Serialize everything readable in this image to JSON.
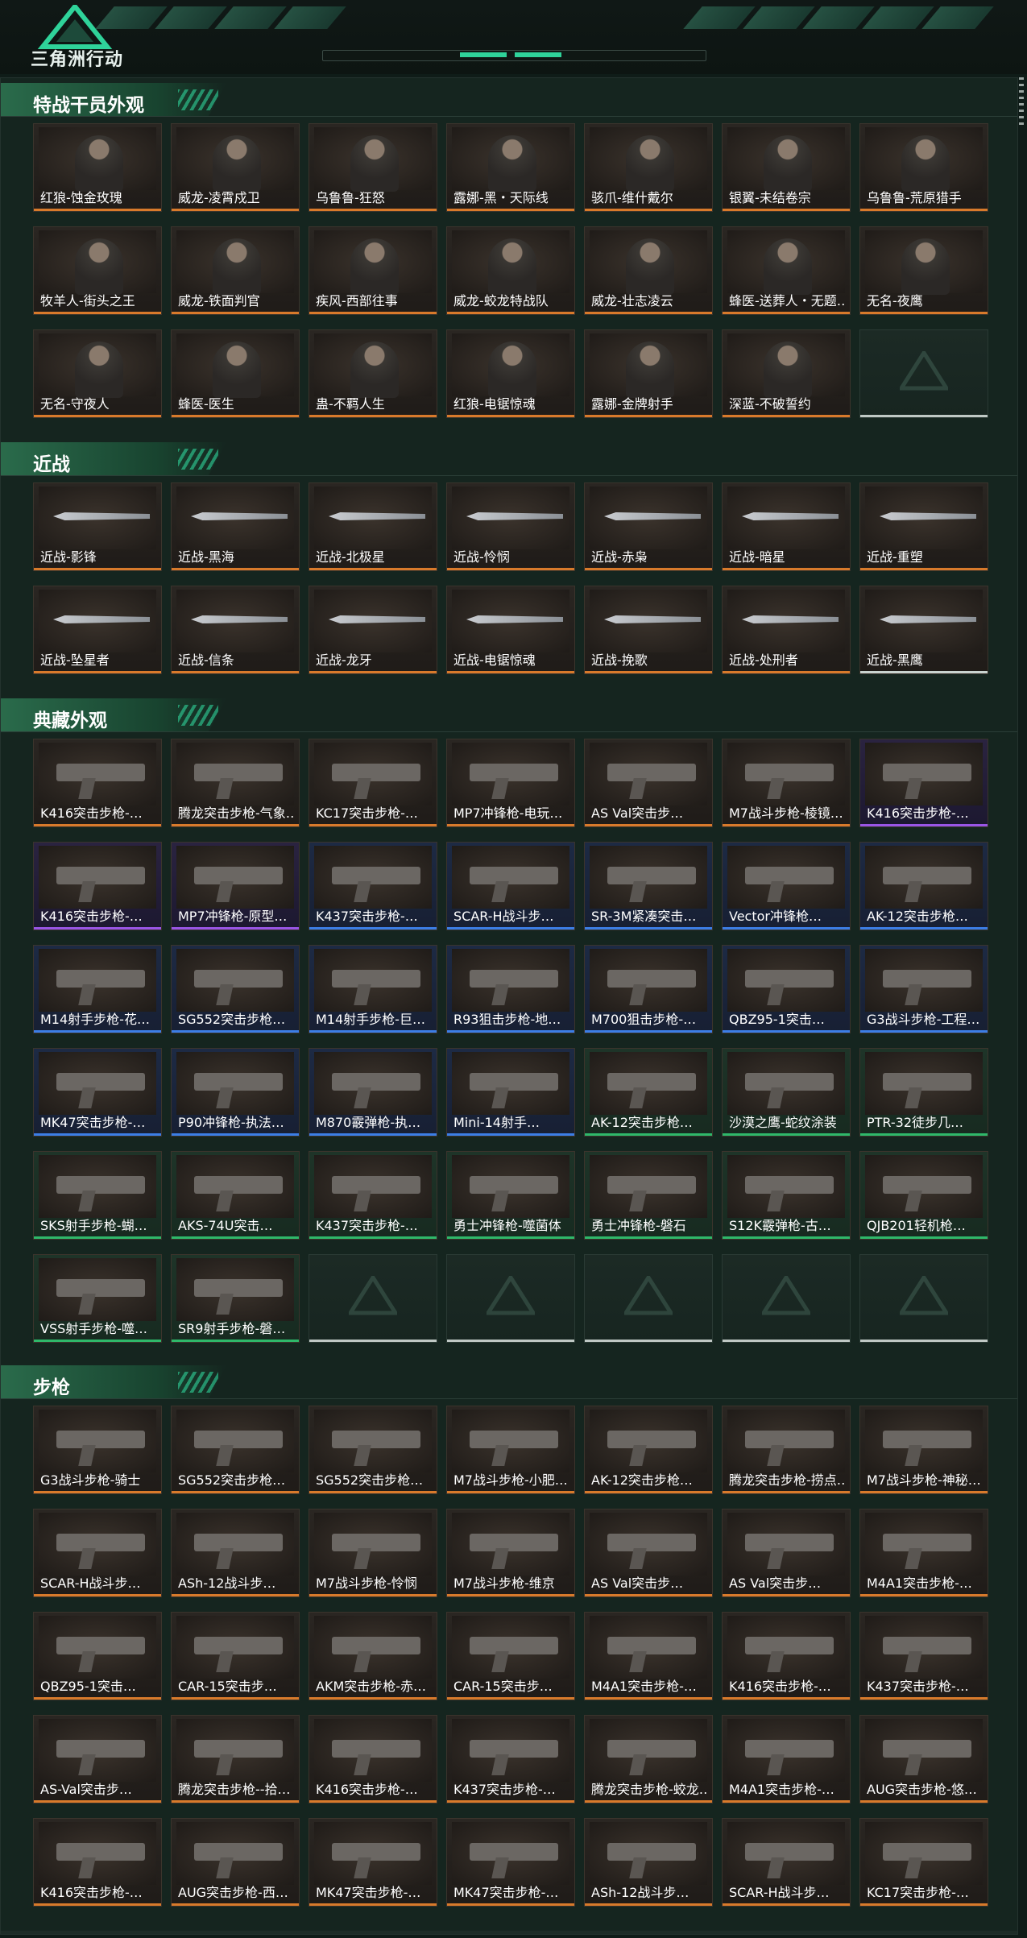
{
  "header": {
    "logo_text": "三角洲行动"
  },
  "sections": [
    {
      "title": "特战干员外观",
      "items": [
        {
          "name": "红狼-蚀金玫瑰",
          "rarity": "red"
        },
        {
          "name": "威龙-凌霄戍卫",
          "rarity": "red"
        },
        {
          "name": "乌鲁鲁-狂怒",
          "rarity": "red"
        },
        {
          "name": "露娜-黑・天际线",
          "rarity": "red"
        },
        {
          "name": "骇爪-维什戴尔",
          "rarity": "red"
        },
        {
          "name": "银翼-未结卷宗",
          "rarity": "orange"
        },
        {
          "name": "乌鲁鲁-荒原猎手",
          "rarity": "orange"
        },
        {
          "name": "牧羊人-街头之王",
          "rarity": "orange"
        },
        {
          "name": "威龙-铁面判官",
          "rarity": "orange"
        },
        {
          "name": "疾风-西部往事",
          "rarity": "orange"
        },
        {
          "name": "威龙-蛟龙特战队",
          "rarity": "orange"
        },
        {
          "name": "威龙-壮志凌云",
          "rarity": "orange"
        },
        {
          "name": "蜂医-送葬人・无题…",
          "rarity": "orange"
        },
        {
          "name": "无名-夜鹰",
          "rarity": "orange"
        },
        {
          "name": "无名-守夜人",
          "rarity": "orange"
        },
        {
          "name": "蜂医-医生",
          "rarity": "orange"
        },
        {
          "name": "蛊-不羁人生",
          "rarity": "orange"
        },
        {
          "name": "红狼-电锯惊魂",
          "rarity": "orange"
        },
        {
          "name": "露娜-金牌射手",
          "rarity": "orange"
        },
        {
          "name": "深蓝-不破誓约",
          "rarity": "orange"
        },
        {
          "name": "",
          "rarity": "empty"
        }
      ]
    },
    {
      "title": "近战",
      "items": [
        {
          "name": "近战-影锋",
          "rarity": "orange"
        },
        {
          "name": "近战-黑海",
          "rarity": "orange"
        },
        {
          "name": "近战-北极星",
          "rarity": "orange"
        },
        {
          "name": "近战-怜悯",
          "rarity": "orange"
        },
        {
          "name": "近战-赤枭",
          "rarity": "orange"
        },
        {
          "name": "近战-暗星",
          "rarity": "orange"
        },
        {
          "name": "近战-重塑",
          "rarity": "orange"
        },
        {
          "name": "近战-坠星者",
          "rarity": "orange"
        },
        {
          "name": "近战-信条",
          "rarity": "orange"
        },
        {
          "name": "近战-龙牙",
          "rarity": "orange"
        },
        {
          "name": "近战-电锯惊魂",
          "rarity": "orange"
        },
        {
          "name": "近战-挽歌",
          "rarity": "orange"
        },
        {
          "name": "近战-处刑者",
          "rarity": "orange"
        },
        {
          "name": "近战-黑鹰",
          "rarity": "white"
        }
      ]
    },
    {
      "title": "典藏外观",
      "items": [
        {
          "name": "K416突击步枪-…",
          "rarity": "orange"
        },
        {
          "name": "腾龙突击步枪-气象…",
          "rarity": "orange"
        },
        {
          "name": "KC17突击步枪-…",
          "rarity": "orange"
        },
        {
          "name": "MP7冲锋枪-电玩…",
          "rarity": "orange"
        },
        {
          "name": "AS Val突击步…",
          "rarity": "orange"
        },
        {
          "name": "M7战斗步枪-棱镜…",
          "rarity": "orange"
        },
        {
          "name": "K416突击步枪-…",
          "rarity": "purple"
        },
        {
          "name": "K416突击步枪-…",
          "rarity": "purple"
        },
        {
          "name": "MP7冲锋枪-原型…",
          "rarity": "purple"
        },
        {
          "name": "K437突击步枪-…",
          "rarity": "blue"
        },
        {
          "name": "SCAR-H战斗步…",
          "rarity": "blue"
        },
        {
          "name": "SR-3M紧凑突击…",
          "rarity": "blue"
        },
        {
          "name": "Vector冲锋枪…",
          "rarity": "blue"
        },
        {
          "name": "AK-12突击步枪…",
          "rarity": "blue"
        },
        {
          "name": "M14射手步枪-花…",
          "rarity": "blue"
        },
        {
          "name": "SG552突击步枪…",
          "rarity": "blue"
        },
        {
          "name": "M14射手步枪-巨…",
          "rarity": "blue"
        },
        {
          "name": "R93狙击步枪-地…",
          "rarity": "blue"
        },
        {
          "name": "M700狙击步枪-…",
          "rarity": "blue"
        },
        {
          "name": "QBZ95-1突击…",
          "rarity": "blue"
        },
        {
          "name": "G3战斗步枪-工程…",
          "rarity": "blue"
        },
        {
          "name": "MK47突击步枪-…",
          "rarity": "blue"
        },
        {
          "name": "P90冲锋枪-执法…",
          "rarity": "blue"
        },
        {
          "name": "M870霰弹枪-执…",
          "rarity": "blue"
        },
        {
          "name": "Mini-14射手…",
          "rarity": "blue"
        },
        {
          "name": "AK-12突击步枪…",
          "rarity": "green"
        },
        {
          "name": "沙漠之鹰-蛇纹涂装",
          "rarity": "green"
        },
        {
          "name": "PTR-32徒步几…",
          "rarity": "green"
        },
        {
          "name": "SKS射手步枪-蝴…",
          "rarity": "green"
        },
        {
          "name": "AKS-74U突击…",
          "rarity": "green"
        },
        {
          "name": "K437突击步枪-…",
          "rarity": "green"
        },
        {
          "name": "勇士冲锋枪-噬菌体",
          "rarity": "green"
        },
        {
          "name": "勇士冲锋枪-磐石",
          "rarity": "green"
        },
        {
          "name": "S12K霰弹枪-古…",
          "rarity": "green"
        },
        {
          "name": "QJB201轻机枪…",
          "rarity": "green"
        },
        {
          "name": "VSS射手步枪-噬…",
          "rarity": "green"
        },
        {
          "name": "SR9射手步枪-磐…",
          "rarity": "green"
        },
        {
          "name": "",
          "rarity": "empty"
        },
        {
          "name": "",
          "rarity": "empty"
        },
        {
          "name": "",
          "rarity": "empty"
        },
        {
          "name": "",
          "rarity": "empty"
        },
        {
          "name": "",
          "rarity": "empty"
        }
      ]
    },
    {
      "title": "步枪",
      "items": [
        {
          "name": "G3战斗步枪-骑士",
          "rarity": "orange"
        },
        {
          "name": "SG552突击步枪…",
          "rarity": "orange"
        },
        {
          "name": "SG552突击步枪…",
          "rarity": "orange"
        },
        {
          "name": "M7战斗步枪-小肥…",
          "rarity": "orange"
        },
        {
          "name": "AK-12突击步枪…",
          "rarity": "orange"
        },
        {
          "name": "腾龙突击步枪-捞点…",
          "rarity": "orange"
        },
        {
          "name": "M7战斗步枪-神秘…",
          "rarity": "orange"
        },
        {
          "name": "SCAR-H战斗步…",
          "rarity": "orange"
        },
        {
          "name": "ASh-12战斗步…",
          "rarity": "orange"
        },
        {
          "name": "M7战斗步枪-怜悯",
          "rarity": "orange"
        },
        {
          "name": "M7战斗步枪-维京",
          "rarity": "orange"
        },
        {
          "name": "AS Val突击步…",
          "rarity": "orange"
        },
        {
          "name": "AS Val突击步…",
          "rarity": "orange"
        },
        {
          "name": "M4A1突击步枪-…",
          "rarity": "orange"
        },
        {
          "name": "QBZ95-1突击…",
          "rarity": "orange"
        },
        {
          "name": "CAR-15突击步…",
          "rarity": "orange"
        },
        {
          "name": "AKM突击步枪-赤…",
          "rarity": "orange"
        },
        {
          "name": "CAR-15突击步…",
          "rarity": "orange"
        },
        {
          "name": "M4A1突击步枪-…",
          "rarity": "orange"
        },
        {
          "name": "K416突击步枪-…",
          "rarity": "orange"
        },
        {
          "name": "K437突击步枪-…",
          "rarity": "orange"
        },
        {
          "name": "AS-Val突击步…",
          "rarity": "orange"
        },
        {
          "name": "腾龙突击步枪--拾…",
          "rarity": "orange"
        },
        {
          "name": "K416突击步枪-…",
          "rarity": "orange"
        },
        {
          "name": "K437突击步枪-…",
          "rarity": "orange"
        },
        {
          "name": "腾龙突击步枪-蛟龙…",
          "rarity": "orange"
        },
        {
          "name": "M4A1突击步枪-…",
          "rarity": "orange"
        },
        {
          "name": "AUG突击步枪-悠…",
          "rarity": "orange"
        },
        {
          "name": "K416突击步枪-…",
          "rarity": "orange"
        },
        {
          "name": "AUG突击步枪-西…",
          "rarity": "orange"
        },
        {
          "name": "MK47突击步枪-…",
          "rarity": "orange"
        },
        {
          "name": "MK47突击步枪-…",
          "rarity": "orange"
        },
        {
          "name": "ASh-12战斗步…",
          "rarity": "orange"
        },
        {
          "name": "SCAR-H战斗步…",
          "rarity": "orange"
        },
        {
          "name": "KC17突击步枪-…",
          "rarity": "orange"
        }
      ]
    }
  ],
  "colors": {
    "accent": "#2fd39a",
    "rarity_orange": "#d87a2b",
    "rarity_purple": "#9a55e6",
    "rarity_blue": "#3c7ee6",
    "rarity_green": "#2fb86a",
    "rarity_white": "#c9d3cf"
  }
}
